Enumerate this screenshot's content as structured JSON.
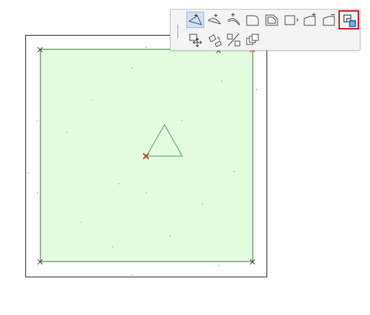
{
  "canvas": {
    "fill_color": "#e3fce0",
    "fill_edge_color": "#2e6b33",
    "contour_color": "#1a1a1a",
    "selection_marker_color": "#d01818",
    "triangle_color": "#3d9e3d"
  },
  "pet_palette": {
    "row1": [
      {
        "icon": "insert-new-node-icon",
        "active": true
      },
      {
        "icon": "insert-new-node-curved-icon"
      },
      {
        "icon": "curve-edge-icon"
      },
      {
        "icon": "fillet-corner-icon"
      },
      {
        "icon": "offset-edge-icon"
      },
      {
        "icon": "offset-all-edges-icon"
      },
      {
        "icon": "add-to-polygon-icon"
      },
      {
        "icon": "subtract-from-polygon-icon"
      },
      {
        "icon": "edit-hatch-icon",
        "highlighted": true,
        "highlight_color": "#c0141a"
      }
    ],
    "row2": [
      {
        "icon": "drag-icon"
      },
      {
        "icon": "rotate-icon"
      },
      {
        "icon": "mirror-icon"
      },
      {
        "icon": "multiply-icon"
      }
    ]
  }
}
